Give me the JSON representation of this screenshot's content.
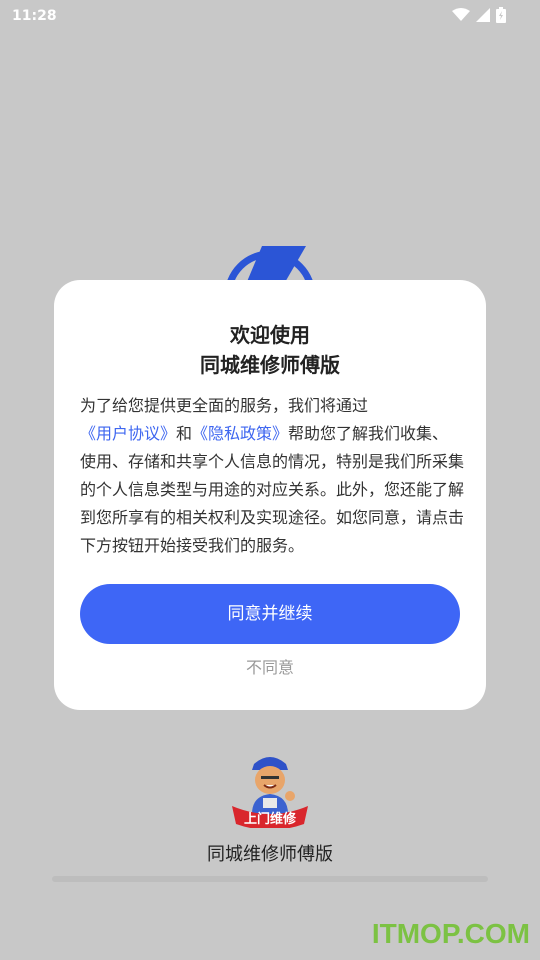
{
  "status_bar": {
    "time": "11:28"
  },
  "dialog": {
    "title_line1": "欢迎使用",
    "title_line2": "同城维修师傅版",
    "body_prefix": "为了给您提供更全面的服务，我们将通过",
    "user_agreement_link": "《用户协议》",
    "and_text": "和",
    "privacy_policy_link": "《隐私政策》",
    "body_suffix": "帮助您了解我们收集、使用、存储和共享个人信息的情况，特别是我们所采集的个人信息类型与用途的对应关系。此外，您还能了解到您所享有的相关权利及实现途径。如您同意，请点击下方按钮开始接受我们的服务。",
    "agree_button": "同意并继续",
    "disagree_button": "不同意"
  },
  "splash": {
    "badge_text": "上门维修",
    "app_name": "同城维修师傅版"
  },
  "watermark": "ITMOP.COM",
  "colors": {
    "accent": "#3e66f6",
    "link": "#3e66f0",
    "backdrop": "#c8c8c8",
    "watermark": "#7cc243"
  }
}
